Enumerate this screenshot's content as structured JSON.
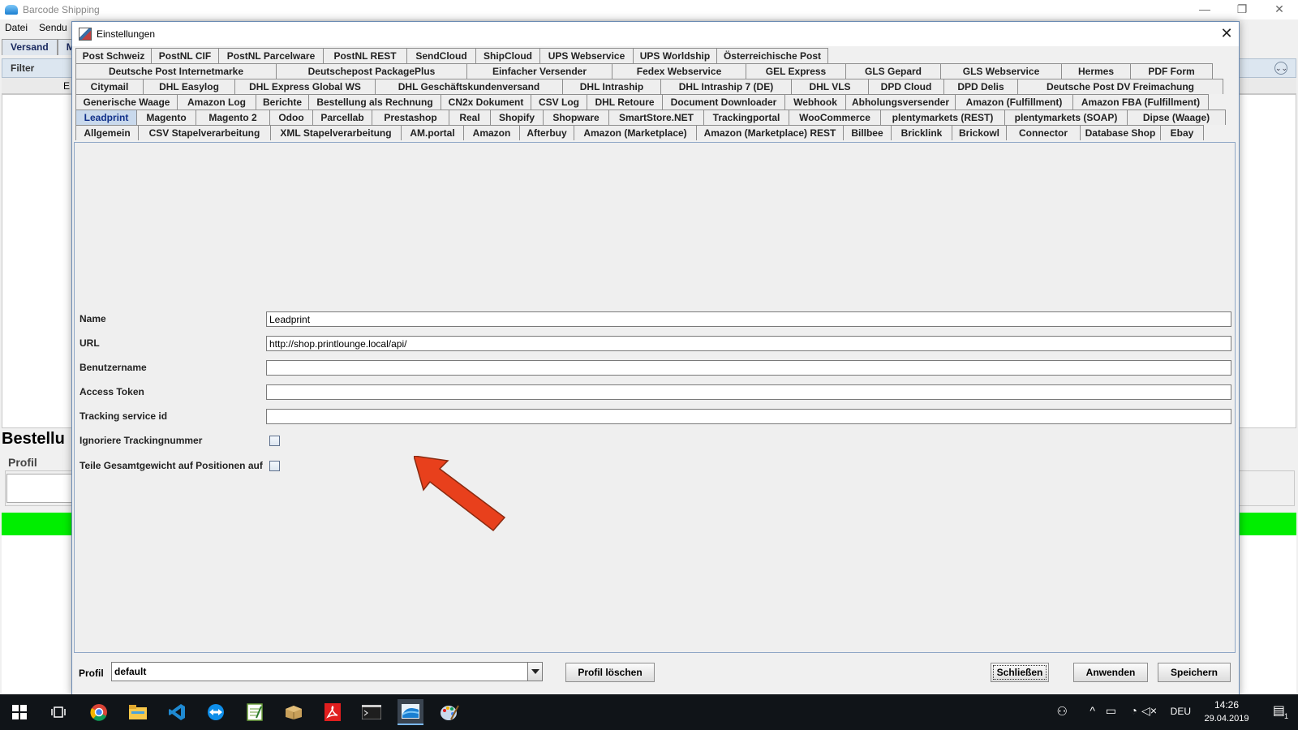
{
  "main_window": {
    "title": "Barcode Shipping",
    "menu": [
      "Datei",
      "Sendu"
    ],
    "tabs": [
      "Versand",
      "M"
    ],
    "filter_label": "Filter",
    "grid_header_char": "E",
    "heading": "Bestellu",
    "profil_label": "Profil"
  },
  "dialog": {
    "title": "Einstellungen",
    "tab_rows": [
      [
        "Post Schweiz",
        "PostNL CIF",
        "PostNL Parcelware",
        "PostNL REST",
        "SendCloud",
        "ShipCloud",
        "UPS Webservice",
        "UPS Worldship",
        "Österreichische Post"
      ],
      [
        "Deutsche Post Internetmarke",
        "Deutschepost PackagePlus",
        "Einfacher Versender",
        "Fedex Webservice",
        "GEL Express",
        "GLS Gepard",
        "GLS Webservice",
        "Hermes",
        "PDF Form"
      ],
      [
        "Citymail",
        "DHL Easylog",
        "DHL Express Global WS",
        "DHL Geschäftskundenversand",
        "DHL Intraship",
        "DHL Intraship 7 (DE)",
        "DHL VLS",
        "DPD Cloud",
        "DPD Delis",
        "Deutsche Post DV Freimachung"
      ],
      [
        "Generische Waage",
        "Amazon Log",
        "Berichte",
        "Bestellung als Rechnung",
        "CN2x Dokument",
        "CSV Log",
        "DHL Retoure",
        "Document Downloader",
        "Webhook",
        "Abholungsversender",
        "Amazon (Fulfillment)",
        "Amazon FBA (Fulfillment)"
      ],
      [
        "Leadprint",
        "Magento",
        "Magento 2",
        "Odoo",
        "Parcellab",
        "Prestashop",
        "Real",
        "Shopify",
        "Shopware",
        "SmartStore.NET",
        "Trackingportal",
        "WooCommerce",
        "plentymarkets (REST)",
        "plentymarkets (SOAP)",
        "Dipse (Waage)"
      ],
      [
        "Allgemein",
        "CSV Stapelverarbeitung",
        "XML Stapelverarbeitung",
        "AM.portal",
        "Amazon",
        "Afterbuy",
        "Amazon (Marketplace)",
        "Amazon (Marketplace) REST",
        "Billbee",
        "Bricklink",
        "Brickowl",
        "Connector",
        "Database Shop",
        "Ebay"
      ]
    ],
    "active_tab": "Leadprint",
    "form": {
      "name_label": "Name",
      "name_value": "Leadprint",
      "url_label": "URL",
      "url_value": "http://shop.printlounge.local/api/",
      "username_label": "Benutzername",
      "username_value": "",
      "token_label": "Access Token",
      "token_value": "",
      "tracking_label": "Tracking service id",
      "tracking_value": "",
      "ignore_tracking_label": "Ignoriere Trackingnummer",
      "ignore_tracking_checked": false,
      "split_weight_label": "Teile Gesamtgewicht auf Positionen auf",
      "split_weight_checked": false
    },
    "bottom": {
      "profil_label": "Profil",
      "profil_value": "default",
      "delete_profile": "Profil löschen",
      "close": "Schließen",
      "apply": "Anwenden",
      "save": "Speichern"
    }
  },
  "annotation": {
    "arrow_color": "#e8401c"
  },
  "taskbar": {
    "items": [
      "windows-start",
      "task-view",
      "chrome",
      "file-explorer",
      "vscode",
      "teamviewer",
      "notepad",
      "package",
      "acrobat",
      "terminal",
      "barcode-shipping",
      "paint"
    ],
    "active_item": "barcode-shipping",
    "language": "DEU",
    "time": "14:26",
    "date": "29.04.2019",
    "notification_count": "1"
  }
}
